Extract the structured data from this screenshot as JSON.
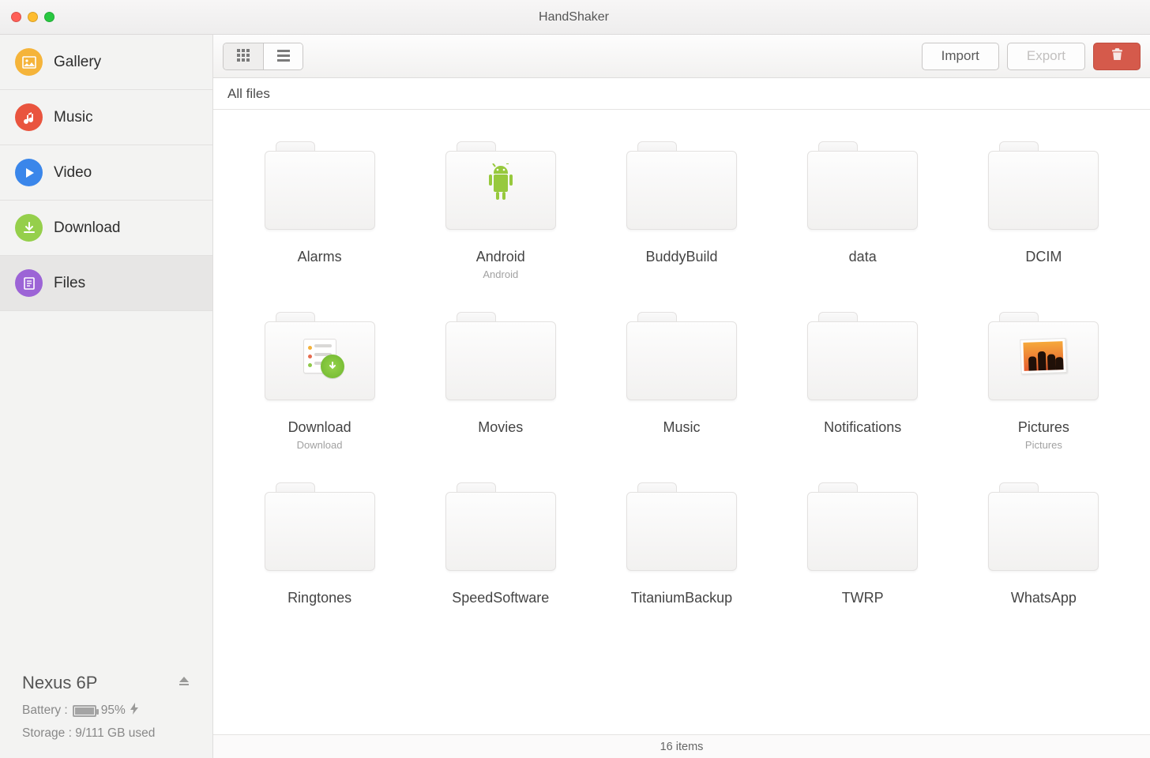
{
  "window": {
    "title": "HandShaker"
  },
  "sidebar": {
    "items": [
      {
        "label": "Gallery",
        "color": "#f5b43a",
        "icon": "image"
      },
      {
        "label": "Music",
        "color": "#e9543e",
        "icon": "note"
      },
      {
        "label": "Video",
        "color": "#3a86ea",
        "icon": "play"
      },
      {
        "label": "Download",
        "color": "#95cf4b",
        "icon": "download"
      },
      {
        "label": "Files",
        "color": "#9c64d6",
        "icon": "file"
      }
    ],
    "active_index": 4
  },
  "device": {
    "name": "Nexus 6P",
    "battery_label": "Battery :",
    "battery_pct": "95%",
    "battery_fill_pct": 95,
    "storage_label": "Storage :",
    "storage_value": "9/111 GB used"
  },
  "toolbar": {
    "view_mode": "grid",
    "import_label": "Import",
    "export_label": "Export",
    "export_disabled": true
  },
  "breadcrumb": "All files",
  "files": [
    {
      "name": "Alarms"
    },
    {
      "name": "Android",
      "sub": "Android",
      "overlay": "android"
    },
    {
      "name": "BuddyBuild"
    },
    {
      "name": "data"
    },
    {
      "name": "DCIM"
    },
    {
      "name": "Download",
      "sub": "Download",
      "overlay": "download"
    },
    {
      "name": "Movies"
    },
    {
      "name": "Music"
    },
    {
      "name": "Notifications"
    },
    {
      "name": "Pictures",
      "sub": "Pictures",
      "overlay": "photo"
    },
    {
      "name": "Ringtones"
    },
    {
      "name": "SpeedSoftware"
    },
    {
      "name": "TitaniumBackup"
    },
    {
      "name": "TWRP"
    },
    {
      "name": "WhatsApp"
    }
  ],
  "status": "16 items"
}
